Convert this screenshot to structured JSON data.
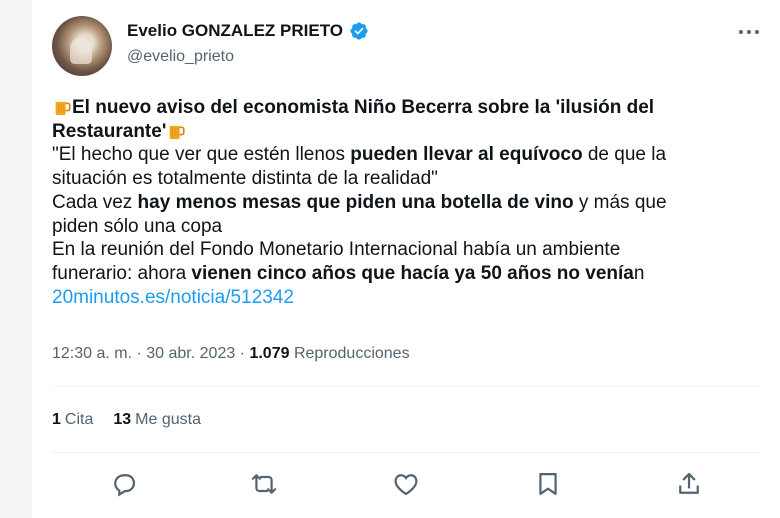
{
  "author": {
    "name": "Evelio GONZALEZ PRIETO",
    "handle": "@evelio_prieto"
  },
  "tweet": {
    "lines": [
      [
        {
          "t": "beer-icon"
        },
        {
          "b": "El nuevo aviso del economista Niño Becerra sobre la 'ilusión del"
        }
      ],
      [
        {
          "b": "Restaurante'"
        },
        {
          "t": "beer-icon"
        }
      ],
      [
        {
          "n": "\"El hecho que ver que estén llenos "
        },
        {
          "b": "pueden llevar al equívoco"
        },
        {
          "n": " de que la"
        }
      ],
      [
        {
          "n": "situación es totalmente distinta de la realidad\""
        }
      ],
      [
        {
          "n": "Cada vez "
        },
        {
          "b": "hay menos mesas que piden una botella de vino"
        },
        {
          "n": " y más que"
        }
      ],
      [
        {
          "n": "piden sólo una copa"
        }
      ],
      [
        {
          "n": "En la reunión del Fondo Monetario Internacional había un ambiente"
        }
      ],
      [
        {
          "n": "funerario: ahora "
        },
        {
          "b": "vienen cinco años que hacía ya 50 años no venía"
        },
        {
          "n": "n"
        }
      ],
      [
        {
          "l": "20minutos.es/noticia/512342"
        }
      ]
    ]
  },
  "meta": {
    "time": "12:30 a. m.",
    "sep1": " · ",
    "date": "30 abr. 2023",
    "sep2": " · ",
    "views": "1.079",
    "views_label": "Reproducciones"
  },
  "stats": {
    "quotes_count": "1",
    "quotes_label": "Cita",
    "likes_count": "13",
    "likes_label": "Me gusta"
  },
  "icons": [
    "verified-badge-icon",
    "more-options-icon",
    "beer-icon",
    "reply-icon",
    "retweet-icon",
    "like-icon",
    "bookmark-icon",
    "share-icon"
  ],
  "colors": {
    "accent": "#1d9bf0",
    "text": "#0f1419",
    "secondary": "#536471"
  }
}
